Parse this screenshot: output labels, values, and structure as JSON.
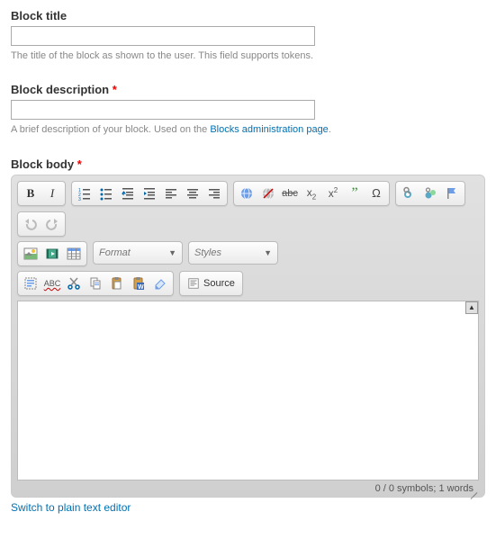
{
  "title_field": {
    "label": "Block title",
    "value": "",
    "help": "The title of the block as shown to the user. This field supports tokens."
  },
  "description_field": {
    "label": "Block description",
    "required_marker": "*",
    "value": "",
    "help_prefix": "A brief description of your block. Used on the ",
    "help_link": "Blocks administration page",
    "help_suffix": "."
  },
  "body_field": {
    "label": "Block body",
    "required_marker": "*"
  },
  "toolbar": {
    "format_label": "Format",
    "styles_label": "Styles",
    "source_label": "Source"
  },
  "statusbar": {
    "text": "0 / 0 symbols; 1 words"
  },
  "switch_link": "Switch to plain text editor"
}
